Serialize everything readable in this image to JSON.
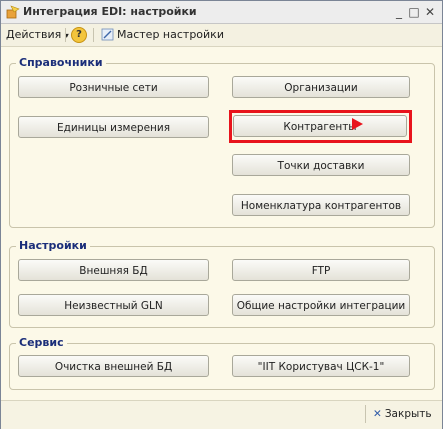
{
  "window": {
    "title": "Интеграция EDI: настройки",
    "minimize": "_",
    "maximize": "□",
    "close": "✕"
  },
  "toolbar": {
    "actions_label": "Действия",
    "help_label": "?",
    "wizard_label": "Мастер настройки"
  },
  "groups": {
    "directories": {
      "title": "Справочники",
      "buttons": {
        "retail_networks": "Розничные сети",
        "organizations": "Организации",
        "units": "Единицы измерения",
        "counterparties": "Контрагенты",
        "delivery_points": "Точки доставки",
        "counterparty_nomenclature": "Номенклатура контрагентов"
      }
    },
    "settings": {
      "title": "Настройки",
      "buttons": {
        "external_db": "Внешняя БД",
        "ftp": "FTP",
        "unknown_gln": "Неизвестный GLN",
        "general_settings": "Общие настройки интеграции"
      }
    },
    "service": {
      "title": "Сервис",
      "buttons": {
        "clear_db": "Очистка внешней БД",
        "iit_user": "\"IIT Користувач ЦСК-1\""
      }
    }
  },
  "footer": {
    "close_label": "Закрыть"
  },
  "colors": {
    "highlight": "#e8141c",
    "group_title": "#1b2e7a",
    "background": "#fcf9e8"
  }
}
